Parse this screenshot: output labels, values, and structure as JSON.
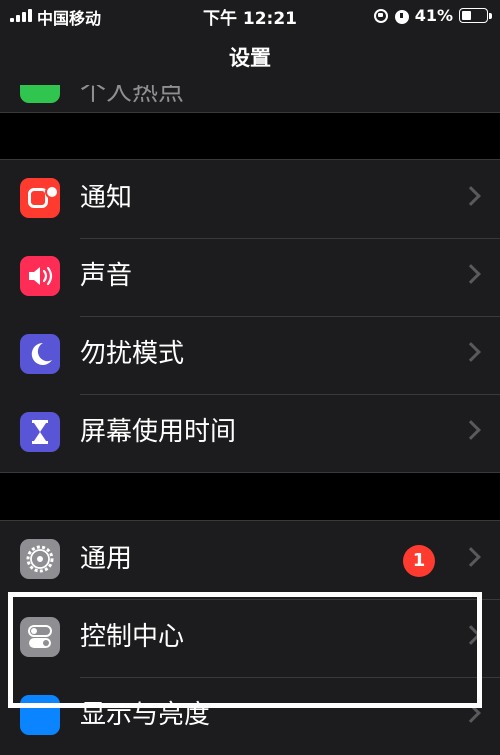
{
  "status_bar": {
    "carrier": "中国移动",
    "time": "下午 12:21",
    "battery_percent": "41%",
    "battery_level": 0.41
  },
  "nav": {
    "title": "设置",
    "previous_row_label": "个人热点"
  },
  "groups": [
    {
      "items": [
        {
          "label": "通知",
          "icon": "notification-icon",
          "color": "#ff3b30"
        },
        {
          "label": "声音",
          "icon": "speaker-icon",
          "color": "#ff2d55"
        },
        {
          "label": "勿扰模式",
          "icon": "moon-icon",
          "color": "#5856d6"
        },
        {
          "label": "屏幕使用时间",
          "icon": "hourglass-icon",
          "color": "#5856d6"
        }
      ]
    },
    {
      "items": [
        {
          "label": "通用",
          "icon": "gear-icon",
          "color": "#8e8e93",
          "badge": "1"
        },
        {
          "label": "控制中心",
          "icon": "toggles-icon",
          "color": "#8e8e93"
        },
        {
          "label": "显示与亮度",
          "icon": "display-icon",
          "color": "#0a84ff"
        }
      ]
    }
  ]
}
